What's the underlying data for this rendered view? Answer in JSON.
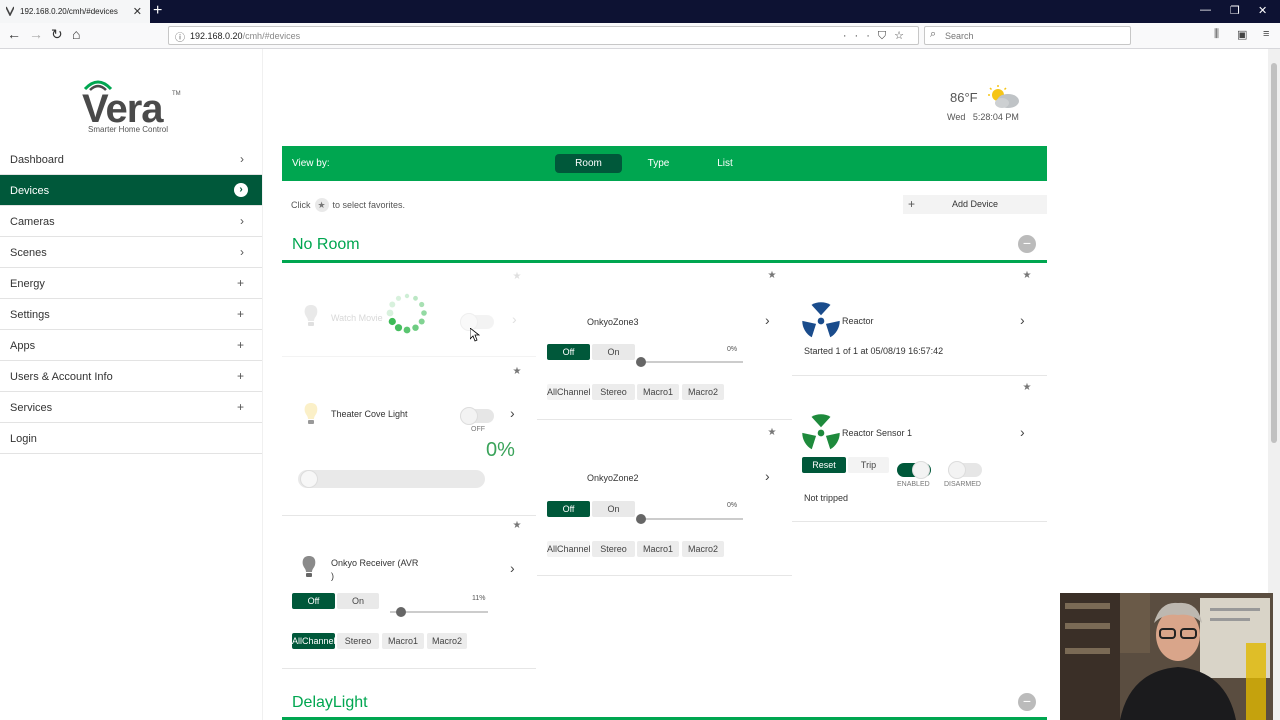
{
  "browser": {
    "tab_title": "192.168.0.20/cmh/#devices",
    "url_host": "192.168.0.20",
    "url_path": "/cmh/#devices",
    "search_placeholder": "Search"
  },
  "logo": {
    "brand": "Vera",
    "trademark": "TM",
    "tagline": "Smarter Home Control"
  },
  "sidebar": {
    "items": [
      {
        "label": "Dashboard",
        "icon": "chevron-right"
      },
      {
        "label": "Devices",
        "icon": "chevron-right",
        "active": true
      },
      {
        "label": "Cameras",
        "icon": "chevron-right"
      },
      {
        "label": "Scenes",
        "icon": "chevron-right"
      },
      {
        "label": "Energy",
        "icon": "plus"
      },
      {
        "label": "Settings",
        "icon": "plus"
      },
      {
        "label": "Apps",
        "icon": "plus"
      },
      {
        "label": "Users & Account Info",
        "icon": "plus"
      },
      {
        "label": "Services",
        "icon": "plus"
      },
      {
        "label": "Login",
        "icon": ""
      }
    ]
  },
  "weather": {
    "temp": "86°F",
    "day": "Wed",
    "time": "5:28:04 PM",
    "icon": "partly-cloudy-icon"
  },
  "viewbar": {
    "label": "View by:",
    "tabs": [
      "Room",
      "Type",
      "List"
    ],
    "active_tab": "Room"
  },
  "hint": {
    "before": "Click",
    "after": "to select favorites."
  },
  "add_device": "Add Device",
  "sections": [
    {
      "title": "No Room"
    },
    {
      "title": "DelayLight"
    }
  ],
  "devices": {
    "watch_movie": {
      "name": "Watch Movie"
    },
    "theater_cove": {
      "name": "Theater Cove Light",
      "state": "OFF",
      "percent": "0%"
    },
    "onkyo_receiver": {
      "name_line1": "Onkyo Receiver (AVR",
      "name_line2": ")",
      "off": "Off",
      "on": "On",
      "percent": "11%",
      "level": 0.11,
      "macros": [
        "AllChannel",
        "Stereo",
        "Macro1",
        "Macro2"
      ]
    },
    "onkyo_zone3": {
      "name": "OnkyoZone3",
      "off": "Off",
      "on": "On",
      "percent": "0%",
      "level": 0,
      "macros": [
        "AllChannel",
        "Stereo",
        "Macro1",
        "Macro2"
      ]
    },
    "onkyo_zone2": {
      "name": "OnkyoZone2",
      "off": "Off",
      "on": "On",
      "percent": "0%",
      "level": 0,
      "macros": [
        "AllChannel",
        "Stereo",
        "Macro1",
        "Macro2"
      ]
    },
    "reactor": {
      "name": "Reactor",
      "status": "Started 1 of 1 at 05/08/19 16:57:42"
    },
    "reactor_sensor": {
      "name": "Reactor Sensor 1",
      "reset": "Reset",
      "trip": "Trip",
      "enabled": "ENABLED",
      "disarmed": "DISARMED",
      "status": "Not tripped"
    }
  },
  "colors": {
    "brand_green": "#00a650",
    "dark_green": "#00583a",
    "reactor_blue": "#1a4c8c",
    "sensor_green": "#1e8a3c"
  }
}
